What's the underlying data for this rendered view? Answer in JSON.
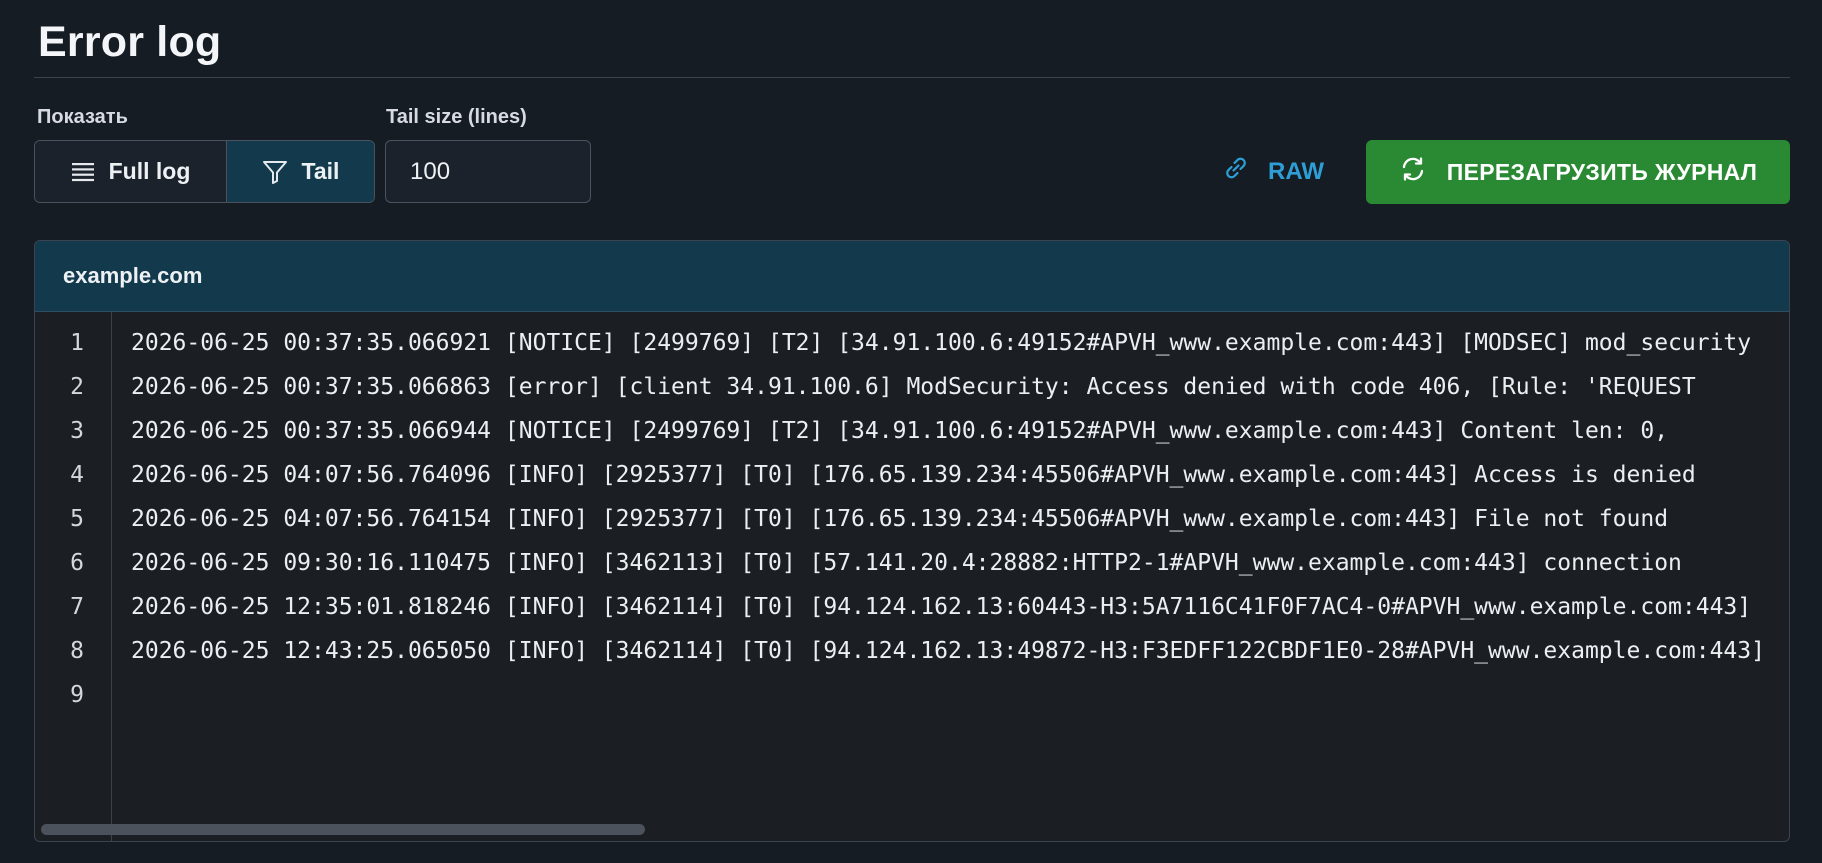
{
  "page": {
    "title": "Error log"
  },
  "controls": {
    "show_label": "Показать",
    "full_log_label": "Full log",
    "tail_label": "Tail",
    "tail_size_label": "Tail size (lines)",
    "tail_size_value": "100",
    "raw_label": "RAW",
    "reload_label": "ПЕРЕЗАГРУЗИТЬ ЖУРНАЛ"
  },
  "log": {
    "host": "example.com",
    "lines": [
      {
        "n": "1",
        "text": "2026-06-25 00:37:35.066921 [NOTICE] [2499769] [T2] [34.91.100.6:49152#APVH_www.example.com:443] [MODSEC] mod_security"
      },
      {
        "n": "2",
        "text": "2026-06-25 00:37:35.066863 [error] [client 34.91.100.6] ModSecurity: Access denied with code 406, [Rule: 'REQUEST"
      },
      {
        "n": "3",
        "text": "2026-06-25 00:37:35.066944 [NOTICE] [2499769] [T2] [34.91.100.6:49152#APVH_www.example.com:443] Content len: 0,"
      },
      {
        "n": "4",
        "text": "2026-06-25 04:07:56.764096 [INFO] [2925377] [T0] [176.65.139.234:45506#APVH_www.example.com:443] Access is denied"
      },
      {
        "n": "5",
        "text": "2026-06-25 04:07:56.764154 [INFO] [2925377] [T0] [176.65.139.234:45506#APVH_www.example.com:443] File not found"
      },
      {
        "n": "6",
        "text": "2026-06-25 09:30:16.110475 [INFO] [3462113] [T0] [57.141.20.4:28882:HTTP2-1#APVH_www.example.com:443] connection"
      },
      {
        "n": "7",
        "text": "2026-06-25 12:35:01.818246 [INFO] [3462114] [T0] [94.124.162.13:60443-H3:5A7116C41F0F7AC4-0#APVH_www.example.com:443]"
      },
      {
        "n": "8",
        "text": "2026-06-25 12:43:25.065050 [INFO] [3462114] [T0] [94.124.162.13:49872-H3:F3EDFF122CBDF1E0-28#APVH_www.example.com:443]"
      },
      {
        "n": "9",
        "text": ""
      }
    ]
  },
  "icons": {
    "full_log": "list-icon",
    "tail": "filter-icon",
    "raw": "link-icon",
    "reload": "refresh-icon"
  },
  "colors": {
    "background": "#161c24",
    "accent_teal": "#123a4c",
    "reload_green": "#2a8a34",
    "link_blue": "#2e9fd6"
  }
}
